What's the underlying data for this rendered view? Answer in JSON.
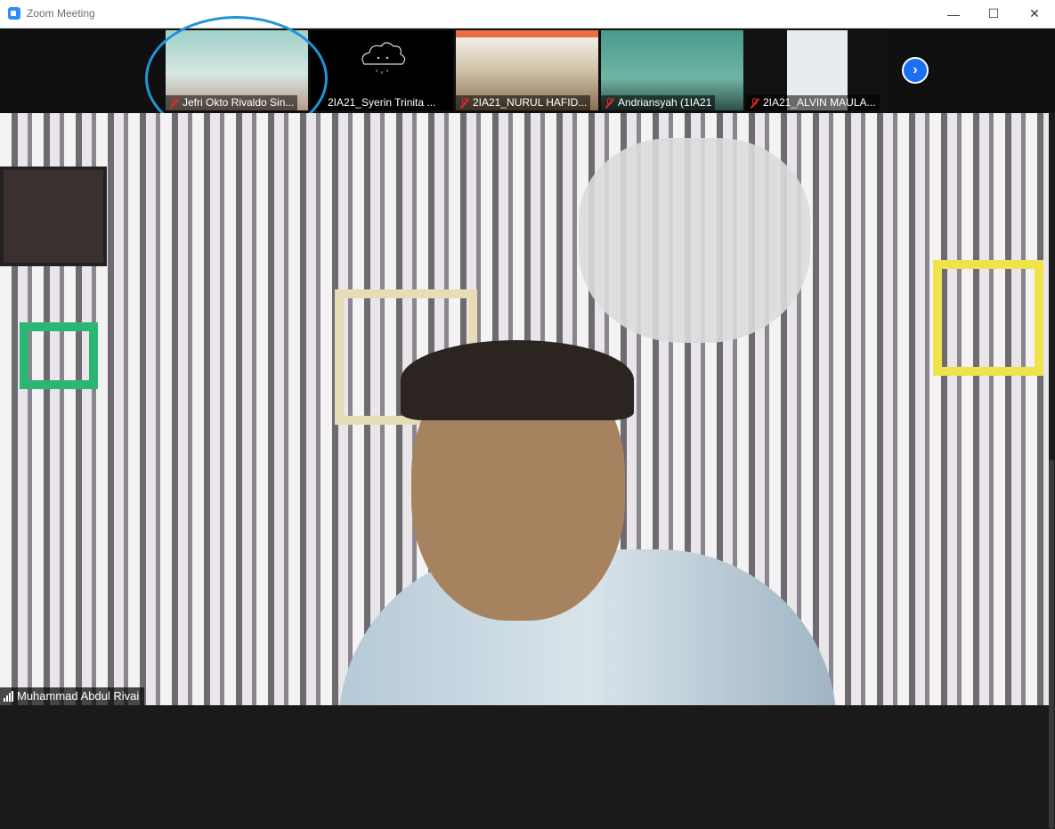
{
  "window": {
    "title": "Zoom Meeting",
    "minimize": "—",
    "maximize": "☐",
    "close": "✕"
  },
  "participants": [
    {
      "name": "Jefri Okto Rivaldo Sin...",
      "muted": true
    },
    {
      "name": "2IA21_Syerin Trinita ...",
      "muted": false
    },
    {
      "name": "2IA21_NURUL HAFID...",
      "muted": true
    },
    {
      "name": "Andriansyah (1IA21",
      "muted": true
    },
    {
      "name": "2IA21_ALVIN MAULA...",
      "muted": true
    }
  ],
  "next_page": "›",
  "active_speaker": {
    "name": "Muhammad Abdul Rivai"
  },
  "colors": {
    "accent": "#2d8cff",
    "highlight_ring": "#1e95d8",
    "muted": "#e02828"
  }
}
